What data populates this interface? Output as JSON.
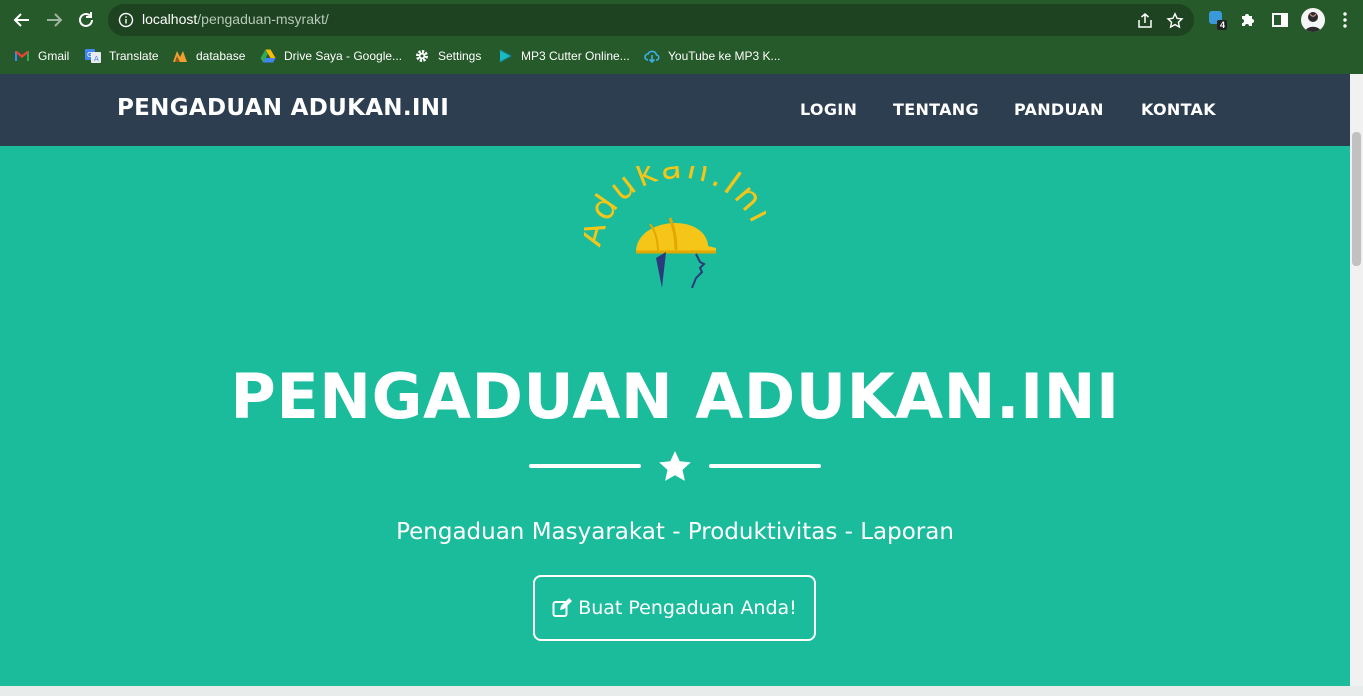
{
  "browser": {
    "url_host": "localhost",
    "url_path": "/pengaduan-msyrakt/",
    "extension_badge": "4",
    "bookmarks": [
      {
        "label": "Gmail",
        "icon": "gmail-icon"
      },
      {
        "label": "Translate",
        "icon": "translate-icon"
      },
      {
        "label": "database",
        "icon": "database-icon"
      },
      {
        "label": "Drive Saya - Google...",
        "icon": "google-drive-icon"
      },
      {
        "label": "Settings",
        "icon": "gear-icon"
      },
      {
        "label": "MP3 Cutter Online...",
        "icon": "play-icon"
      },
      {
        "label": "YouTube ke MP3 K...",
        "icon": "download-cloud-icon"
      }
    ]
  },
  "navbar": {
    "brand": "PENGADUAN ADUKAN.INI",
    "links": [
      "LOGIN",
      "TENTANG",
      "PANDUAN",
      "KONTAK"
    ]
  },
  "hero": {
    "logo_text": "Adukan.Ini",
    "title": "PENGADUAN ADUKAN.INI",
    "subtitle": "Pengaduan Masyarakat - Produktivitas - Laporan",
    "cta_label": "Buat Pengaduan Anda!"
  },
  "colors": {
    "chrome": "#265a2a",
    "navbar": "#2c3e50",
    "masthead": "#1abc9c",
    "logo_yellow": "#f5c518"
  }
}
